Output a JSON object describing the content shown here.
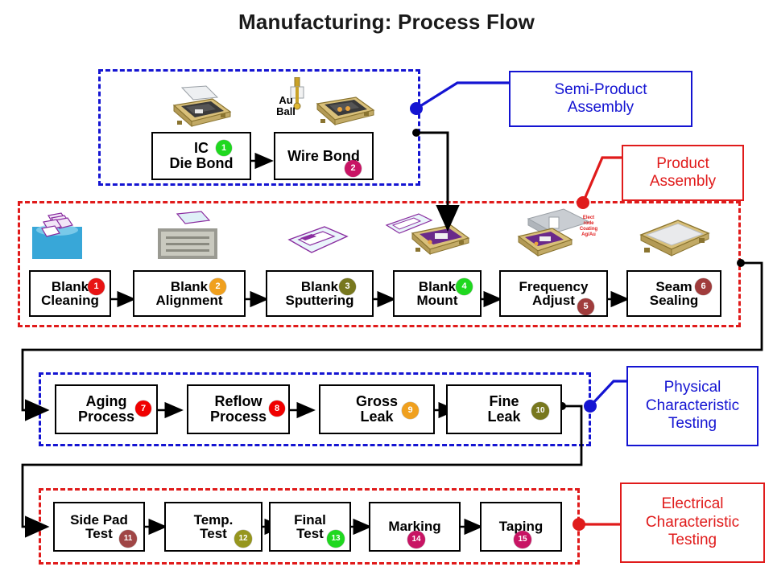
{
  "title": "Manufacturing: Process Flow",
  "groups": [
    {
      "id": "semi-product",
      "label_line1": "Semi-Product",
      "label_line2": "Assembly",
      "label_line3": "",
      "color": "#1414d2",
      "style": "blue"
    },
    {
      "id": "product-assembly",
      "label_line1": "Product",
      "label_line2": "Assembly",
      "label_line3": "",
      "color": "#e01b1b",
      "style": "red"
    },
    {
      "id": "physical-testing",
      "label_line1": "Physical",
      "label_line2": "Characteristic",
      "label_line3": "Testing",
      "color": "#1414d2",
      "style": "blue"
    },
    {
      "id": "electrical-testing",
      "label_line1": "Electrical",
      "label_line2": "Characteristic",
      "label_line3": "Testing",
      "color": "#e01b1b",
      "style": "red"
    }
  ],
  "steps": {
    "s1": {
      "line1": "IC",
      "line2": "Die Bond",
      "number": "1",
      "badge_color": "#1fd81f"
    },
    "s2": {
      "line1": "Wire Bond",
      "line2": "",
      "number": "2",
      "badge_color": "#c81464"
    },
    "s3": {
      "line1": "Blank",
      "line2": "Cleaning",
      "number": "1",
      "badge_color": "#e81414"
    },
    "s4": {
      "line1": "Blank",
      "line2": "Alignment",
      "number": "2",
      "badge_color": "#f0a01e"
    },
    "s5": {
      "line1": "Blank",
      "line2": "Sputtering",
      "number": "3",
      "badge_color": "#78781e"
    },
    "s6": {
      "line1": "Blank",
      "line2": "Mount",
      "number": "4",
      "badge_color": "#1fd81f"
    },
    "s7": {
      "line1": "Frequency",
      "line2": "Adjust",
      "number": "5",
      "badge_color": "#a03c3c"
    },
    "s8": {
      "line1": "Seam",
      "line2": "Sealing",
      "number": "6",
      "badge_color": "#a03c3c"
    },
    "s9": {
      "line1": "Aging",
      "line2": "Process",
      "number": "7",
      "badge_color": "#f00000"
    },
    "s10": {
      "line1": "Reflow",
      "line2": "Process",
      "number": "8",
      "badge_color": "#f00000"
    },
    "s11": {
      "line1": "Gross",
      "line2": "Leak",
      "number": "9",
      "badge_color": "#f0a01e"
    },
    "s12": {
      "line1": "Fine",
      "line2": "Leak",
      "number": "10",
      "badge_color": "#78781e"
    },
    "s13": {
      "line1": "Side Pad",
      "line2": "Test",
      "number": "11",
      "badge_color": "#a04646"
    },
    "s14": {
      "line1": "Temp.",
      "line2": "Test",
      "number": "12",
      "badge_color": "#96961e"
    },
    "s15": {
      "line1": "Final",
      "line2": "Test",
      "number": "13",
      "badge_color": "#1fd81f"
    },
    "s16": {
      "line1": "Marking",
      "line2": "",
      "number": "14",
      "badge_color": "#c81464"
    },
    "s17": {
      "line1": "Taping",
      "line2": "",
      "number": "15",
      "badge_color": "#c81464"
    }
  },
  "annotations": {
    "au_ball_line1": "Au",
    "au_ball_line2": "Ball",
    "electrode_note": "Elect rode Coating Ag/Au"
  },
  "colors": {
    "blue_group": "#1414d2",
    "red_group": "#e01b1b",
    "box_border": "#000000",
    "connector": "#000000"
  }
}
